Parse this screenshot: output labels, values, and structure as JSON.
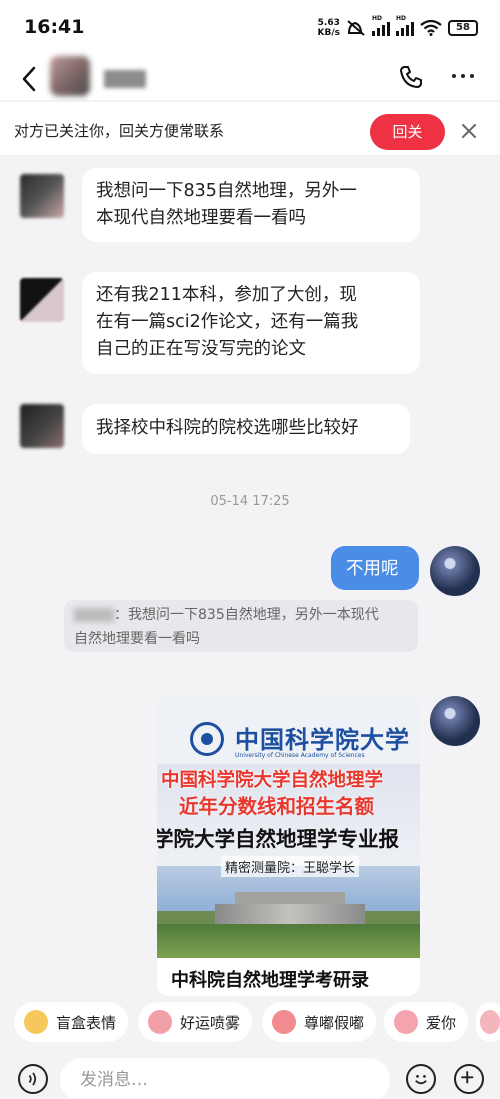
{
  "status_bar": {
    "time": "16:41",
    "net_speed_value": "5.63",
    "net_speed_unit": "KB/s",
    "battery": "58"
  },
  "banner": {
    "text": "对方已关注你，回关方便常联系",
    "follow_back_label": "回关"
  },
  "messages": [
    {
      "from": "other",
      "text_lines": [
        "我想问一下835自然地理，另外一",
        "本现代自然地理要看一看吗"
      ]
    },
    {
      "from": "other",
      "text_lines": [
        "还有我211本科，参加了大创，现",
        "在有一篇sci2作论文，还有一篇我",
        "自己的正在写没写完的论文"
      ]
    },
    {
      "from": "other",
      "text_lines": [
        "我择校中科院的院校选哪些比较好"
      ]
    }
  ],
  "timestamp": "05-14 17:25",
  "reply": {
    "text": "不用呢",
    "quote_prefix": "：",
    "quote_line1": "我想问一下835自然地理，另外一本现代",
    "quote_line2": "自然地理要看一看吗"
  },
  "share_card": {
    "logo_cn": "中国科学院大学",
    "logo_en": "University of Chinese Academy of Sciences",
    "line1": "中国科学院大学自然地理学",
    "line2": "近年分数线和招生名额",
    "line3": "学院大学自然地理学专业报",
    "line4": "精密测量院：王聪学长",
    "title": "中科院自然地理学考研录"
  },
  "emoji_bar": [
    {
      "label": "盲盒表情",
      "icon": "mystery-box-icon",
      "color": "#f6c85b"
    },
    {
      "label": "好运喷雾",
      "icon": "pig-spray-icon",
      "color": "#f2a0a8"
    },
    {
      "label": "尊嘟假嘟",
      "icon": "pig-face-icon",
      "color": "#f28b8f"
    },
    {
      "label": "爱你",
      "icon": "pig-love-icon",
      "color": "#f5a3ad"
    }
  ],
  "input": {
    "placeholder": "发消息…"
  }
}
